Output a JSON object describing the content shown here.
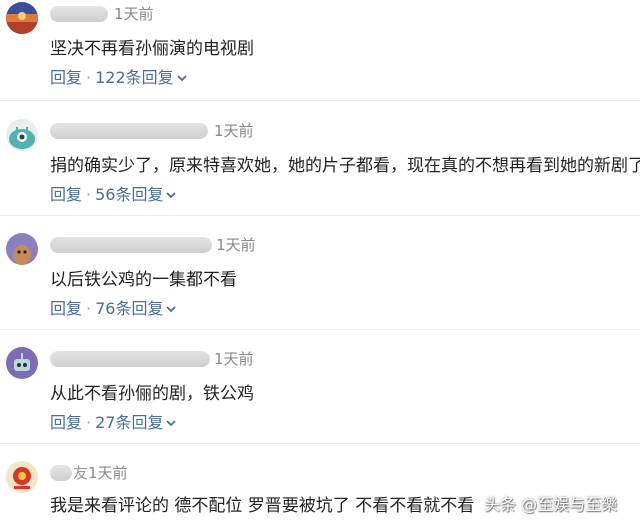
{
  "colors": {
    "link": "#4a6d99",
    "text": "#222222",
    "time": "#8a8a8a",
    "divider": "#ececec"
  },
  "comments": [
    {
      "avatar_icon": "sunset-avatar-icon",
      "time": "1天前",
      "text": "坚决不再看孙俪演的电视剧",
      "reply": "回复",
      "replies": "122条回复"
    },
    {
      "avatar_icon": "teal-alien-avatar-icon",
      "time": "1天前",
      "text": "捐的确实少了，原来特喜欢她，她的片子都看，现在真的不想再看到她的新剧了",
      "reply": "回复",
      "replies": "56条回复"
    },
    {
      "avatar_icon": "purple-creature-avatar-icon",
      "time": "1天前",
      "text": "以后铁公鸡的一集都不看",
      "reply": "回复",
      "replies": "76条回复"
    },
    {
      "avatar_icon": "purple-robot-avatar-icon",
      "time": "1天前",
      "text": "从此不看孙俪的剧，铁公鸡",
      "reply": "回复",
      "replies": "27条回复"
    },
    {
      "avatar_icon": "red-badge-avatar-icon",
      "name_suffix": "友",
      "time": "1天前",
      "text": "我是来看评论的 德不配位 罗晋要被坑了 不看不看就不看"
    }
  ],
  "watermark": "头条 @至娱与至樂"
}
